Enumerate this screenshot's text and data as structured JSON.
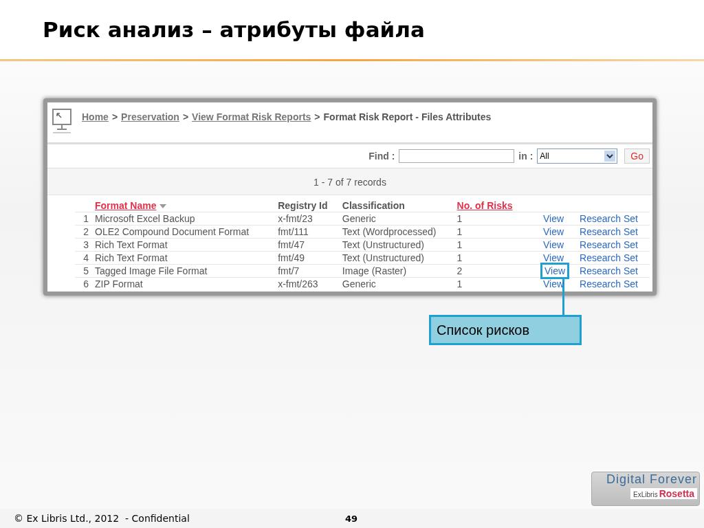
{
  "slide": {
    "title": "Риск анализ – атрибуты файла"
  },
  "breadcrumb_separators": [
    ">",
    ">",
    ">"
  ],
  "breadcrumb": [
    {
      "label": "Home",
      "link": true
    },
    {
      "label": "Preservation",
      "link": true
    },
    {
      "label": "View Format Risk Reports",
      "link": true
    },
    {
      "label": "Format Risk Report - Files Attributes",
      "link": false
    }
  ],
  "search": {
    "find_label": "Find :",
    "in_label": "in :",
    "scope": "All",
    "go": "Go"
  },
  "records": "1 - 7 of 7 records",
  "table": {
    "columns": [
      {
        "label": "Format Name",
        "sortable": true,
        "sorted": true
      },
      {
        "label": "Registry Id",
        "sortable": false,
        "sorted": false
      },
      {
        "label": "Classification",
        "sortable": false,
        "sorted": false
      },
      {
        "label": "No. of Risks",
        "sortable": true,
        "sorted": false
      }
    ],
    "rows": [
      {
        "num": "1",
        "name": "Microsoft Excel Backup",
        "registry": "x-fmt/23",
        "classification": "Generic",
        "risks": "1",
        "view": "View",
        "research": "Research Set",
        "highlighted": false
      },
      {
        "num": "2",
        "name": "OLE2 Compound Document Format",
        "registry": "fmt/111",
        "classification": "Text (Wordprocessed)",
        "risks": "1",
        "view": "View",
        "research": "Research Set",
        "highlighted": false
      },
      {
        "num": "3",
        "name": "Rich Text Format",
        "registry": "fmt/47",
        "classification": "Text (Unstructured)",
        "risks": "1",
        "view": "View",
        "research": "Research Set",
        "highlighted": false
      },
      {
        "num": "4",
        "name": "Rich Text Format",
        "registry": "fmt/49",
        "classification": "Text (Unstructured)",
        "risks": "1",
        "view": "View",
        "research": "Research Set",
        "highlighted": false
      },
      {
        "num": "5",
        "name": "Tagged Image File Format",
        "registry": "fmt/7",
        "classification": "Image (Raster)",
        "risks": "2",
        "view": "View",
        "research": "Research Set",
        "highlighted": true
      },
      {
        "num": "6",
        "name": "ZIP Format",
        "registry": "x-fmt/263",
        "classification": "Generic",
        "risks": "1",
        "view": "View",
        "research": "Research Set",
        "highlighted": false
      }
    ]
  },
  "callout": "Список рисков",
  "logo": {
    "tagline": "Digital Forever",
    "brand": "ExLibris",
    "product": "Rosetta"
  },
  "footer": {
    "copyright": "© Ex Libris Ltd., 2012  - Confidential",
    "page": "49"
  }
}
